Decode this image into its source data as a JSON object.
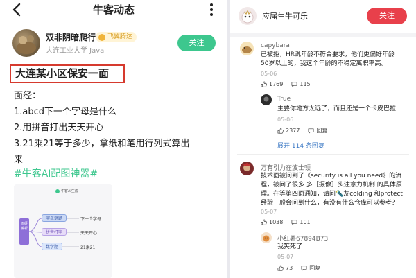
{
  "left": {
    "nav_title": "牛客动态",
    "author": {
      "name": "双非阴暗爬行",
      "badge": "飞翼腾达",
      "school": "大连工业大学 Java",
      "follow_label": "关注"
    },
    "post": {
      "title": "大连某小区保安一面",
      "lines": [
        "面经：",
        "1.abcd下一个字母是什么",
        "2.用拼音打出天天开心",
        "3.21乘21等于多少，拿纸和笔用行列式算出",
        "来"
      ],
      "hashtag": "#牛客AI配图神器#"
    },
    "mindmap": {
      "brand": "牛客AI生成",
      "root": "面经解析",
      "nodes": [
        "字母谜题",
        "拼音打字",
        "数学题"
      ],
      "leaves": [
        "下一个字母",
        "天天开心",
        "21乘21"
      ]
    }
  },
  "right": {
    "header": {
      "name": "应届生牛可乐",
      "follow_label": "关注"
    },
    "comments": [
      {
        "user": "capybara",
        "text": "已被拒，HR说年龄不符合要求，他们更偏好年龄50岁以上的，我这个年龄的不稳定离职率高。",
        "date": "05-06",
        "likes": "1769",
        "replies": "115"
      },
      {
        "user": "True",
        "text": "主要你地方太远了，而且还是一个卡皮巴拉",
        "date": "05-06",
        "likes": "2377",
        "reply_label": "回复",
        "expand": "展开 114 条回复"
      },
      {
        "user": "万有引力在波士顿",
        "text": "技术面被问到了《security is all you need》的流程，被问了很多 多［摄像］头注意力机制 的具体原理。在等第四面通知，请问🔦友colding 和protect 经验一般会问到什么，有没有什么仓库可以参考？",
        "date": "05-07",
        "likes": "1038",
        "replies": "101"
      },
      {
        "user": "小红薯67894B73",
        "text": "我笑死了",
        "date": "05-07",
        "likes": "73",
        "reply_label": "回复"
      }
    ]
  },
  "colors": {
    "green": "#3dc78e",
    "red": "#e8404b",
    "highlight_border": "#d63a2e",
    "link": "#3b78c4"
  }
}
